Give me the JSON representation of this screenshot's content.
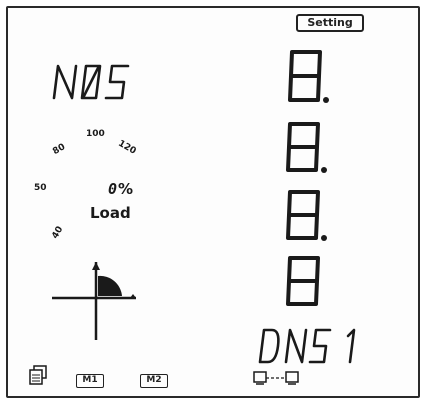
{
  "meter": {
    "setting_label": "Setting",
    "top_left_text": "NØ5",
    "load_label": "Load",
    "load_value": "0",
    "load_unit": "%",
    "scale_labels": [
      "50",
      "100",
      "120",
      "80",
      "40"
    ],
    "digit_rows": [
      "8.",
      "8.",
      "8.",
      "8"
    ],
    "bottom_text": "DN5 1",
    "m1_label": "M1",
    "m2_label": "M2",
    "icons": [
      "page-stack-icon",
      "network-link-icon",
      "quadrant-icon"
    ]
  }
}
